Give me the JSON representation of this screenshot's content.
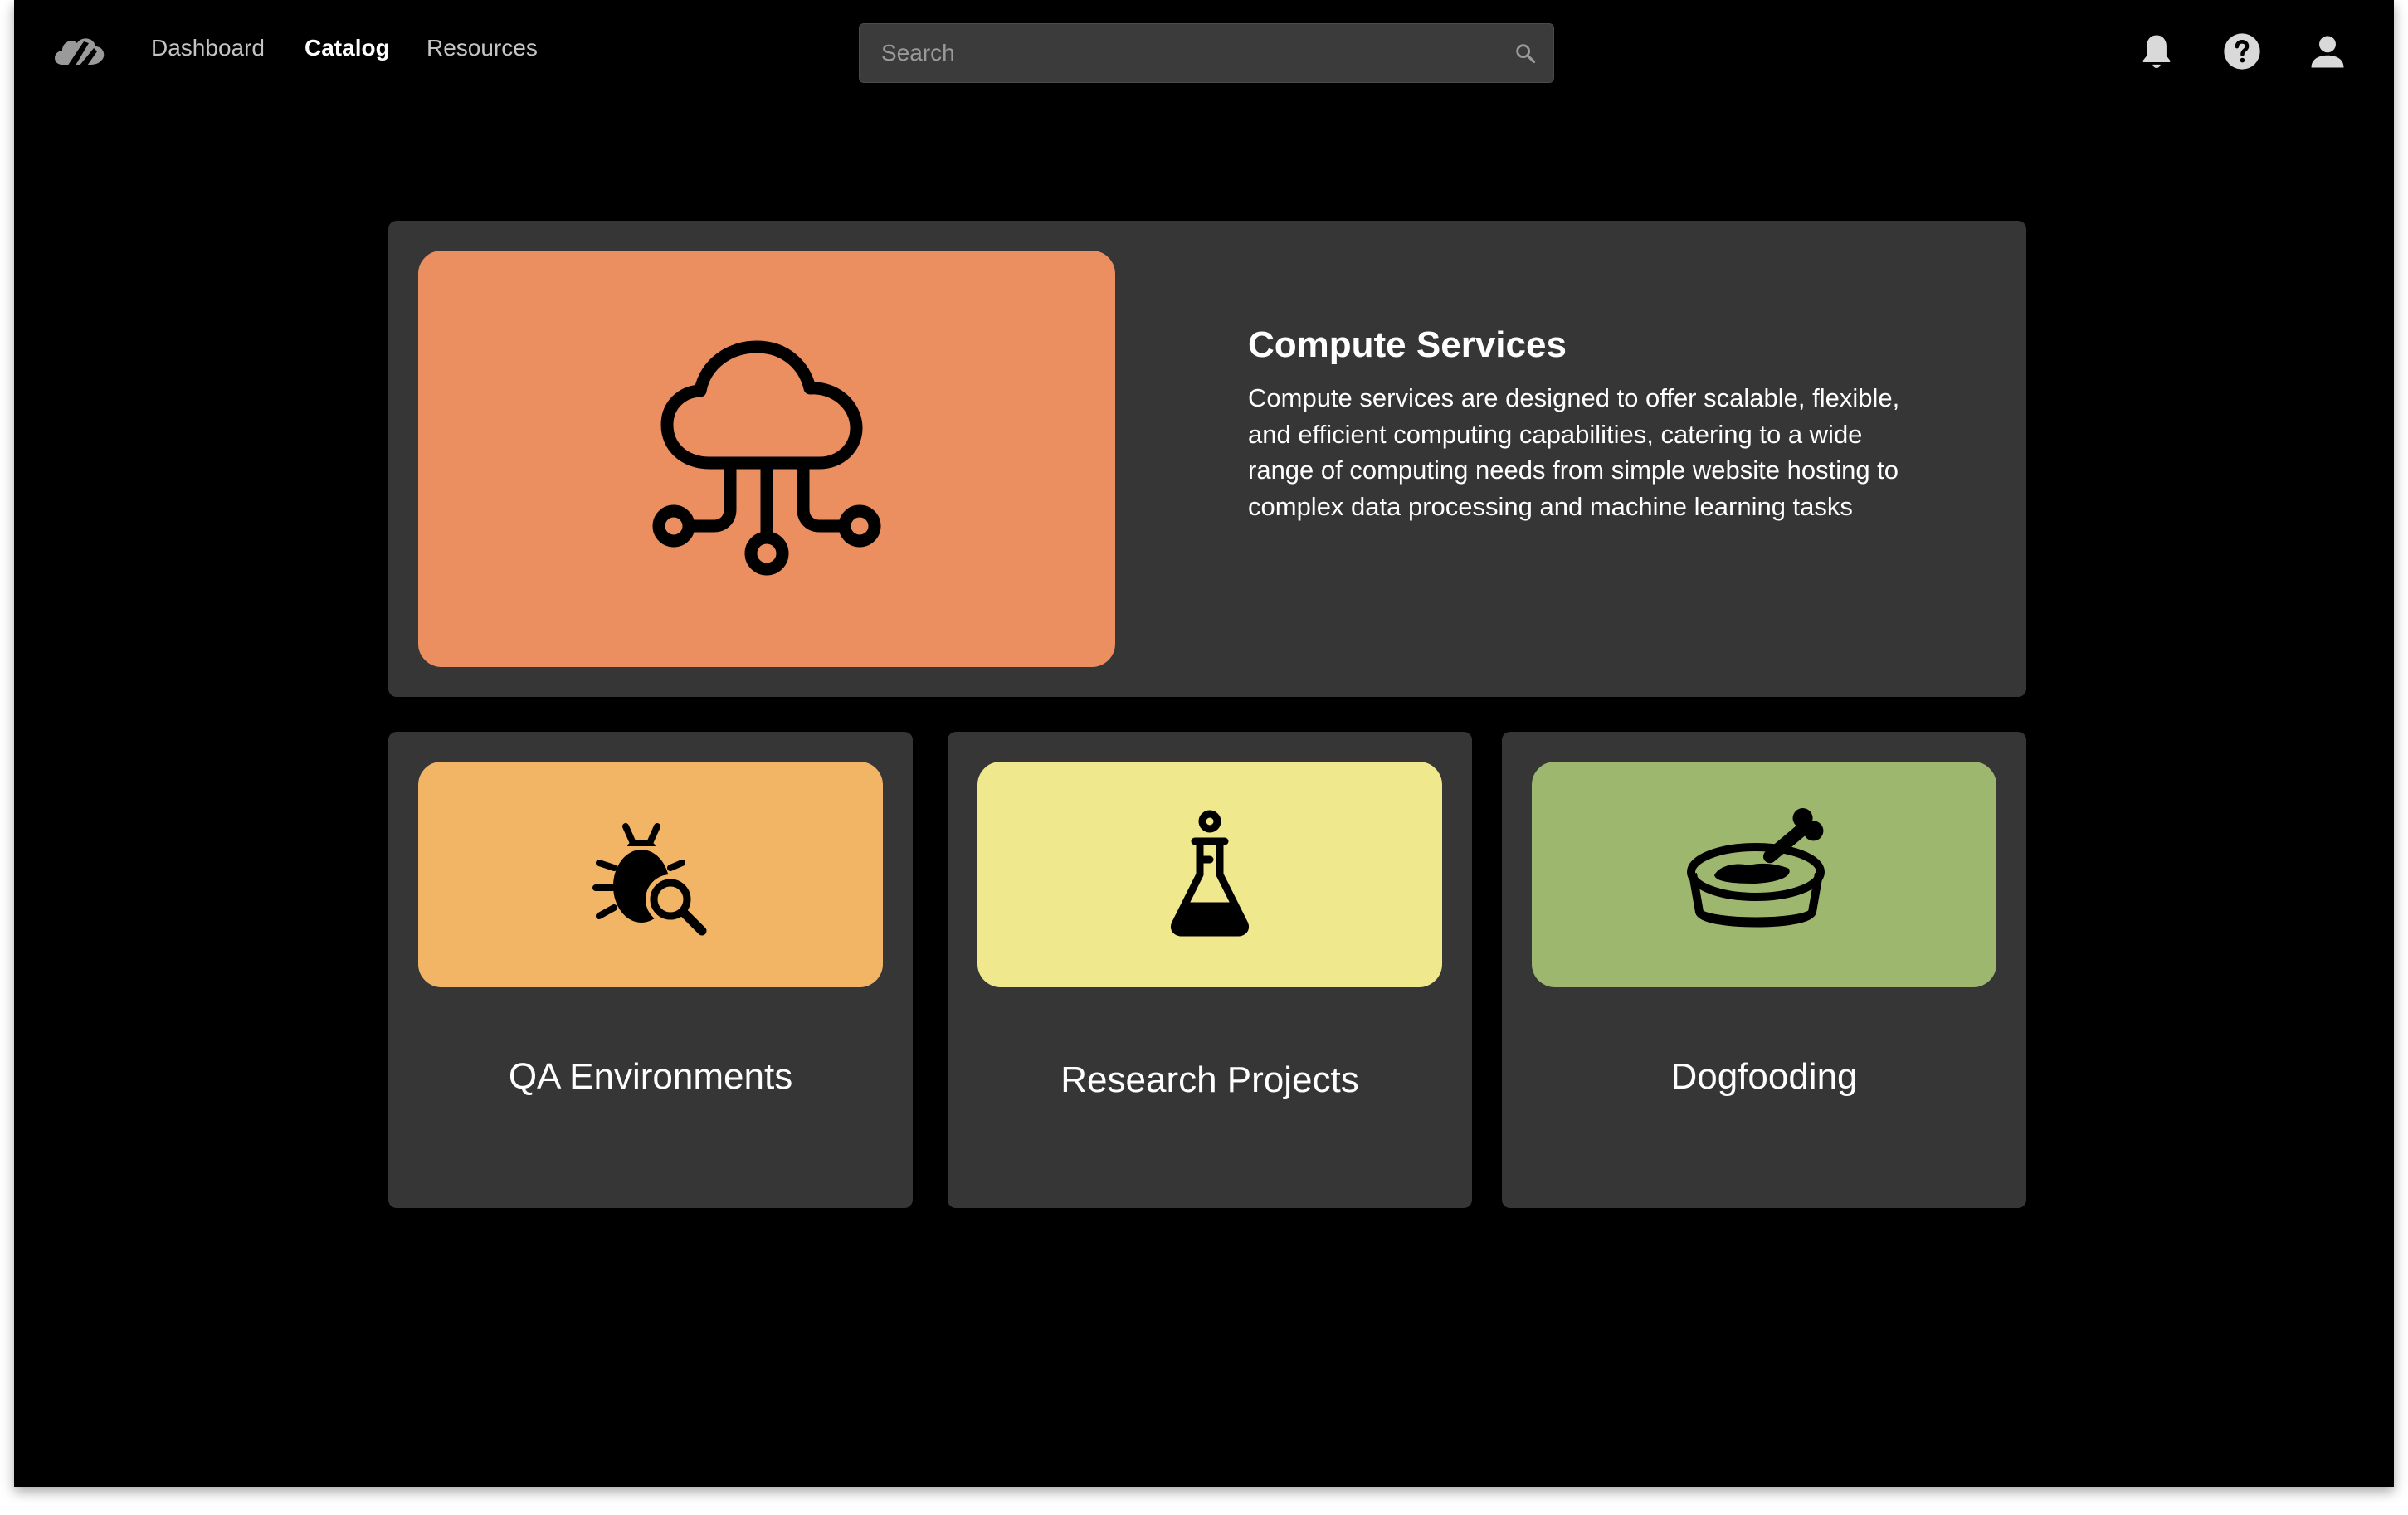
{
  "nav": {
    "links": [
      {
        "label": "Dashboard",
        "active": false
      },
      {
        "label": "Catalog",
        "active": true
      },
      {
        "label": "Resources",
        "active": false
      }
    ]
  },
  "search": {
    "placeholder": "Search",
    "value": ""
  },
  "header_icons": [
    "bell-icon",
    "help-icon",
    "user-icon"
  ],
  "featured": {
    "title": "Compute Services",
    "description": "Compute services are designed to offer scalable, flexible, and efficient computing capabilities, catering to a wide range of computing needs from simple website hosting to complex data processing and machine learning tasks",
    "icon": "cloud-network-icon",
    "color": "#EB8E60"
  },
  "cards": [
    {
      "label": "QA Environments",
      "icon": "bug-search-icon",
      "color": "#F2B566"
    },
    {
      "label": "Research Projects",
      "icon": "flask-icon",
      "color": "#EFE88D"
    },
    {
      "label": "Dogfooding",
      "icon": "dog-bowl-icon",
      "color": "#9DB76E"
    }
  ],
  "colors": {
    "background": "#000000",
    "card": "#363636",
    "search_bg": "#3B3B3B"
  }
}
